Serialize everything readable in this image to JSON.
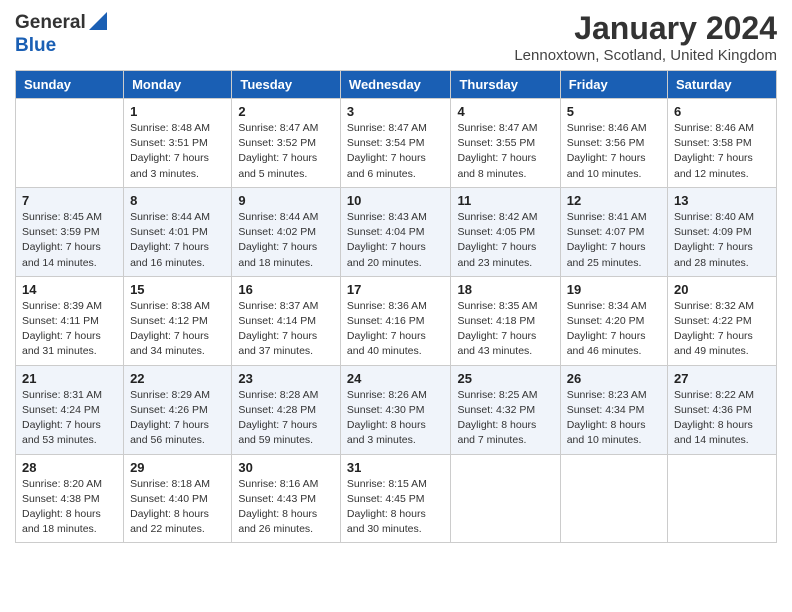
{
  "header": {
    "logo_general": "General",
    "logo_blue": "Blue",
    "month_title": "January 2024",
    "location": "Lennoxtown, Scotland, United Kingdom"
  },
  "days_of_week": [
    "Sunday",
    "Monday",
    "Tuesday",
    "Wednesday",
    "Thursday",
    "Friday",
    "Saturday"
  ],
  "weeks": [
    [
      {
        "number": "",
        "sunrise": "",
        "sunset": "",
        "daylight": ""
      },
      {
        "number": "1",
        "sunrise": "Sunrise: 8:48 AM",
        "sunset": "Sunset: 3:51 PM",
        "daylight": "Daylight: 7 hours and 3 minutes."
      },
      {
        "number": "2",
        "sunrise": "Sunrise: 8:47 AM",
        "sunset": "Sunset: 3:52 PM",
        "daylight": "Daylight: 7 hours and 5 minutes."
      },
      {
        "number": "3",
        "sunrise": "Sunrise: 8:47 AM",
        "sunset": "Sunset: 3:54 PM",
        "daylight": "Daylight: 7 hours and 6 minutes."
      },
      {
        "number": "4",
        "sunrise": "Sunrise: 8:47 AM",
        "sunset": "Sunset: 3:55 PM",
        "daylight": "Daylight: 7 hours and 8 minutes."
      },
      {
        "number": "5",
        "sunrise": "Sunrise: 8:46 AM",
        "sunset": "Sunset: 3:56 PM",
        "daylight": "Daylight: 7 hours and 10 minutes."
      },
      {
        "number": "6",
        "sunrise": "Sunrise: 8:46 AM",
        "sunset": "Sunset: 3:58 PM",
        "daylight": "Daylight: 7 hours and 12 minutes."
      }
    ],
    [
      {
        "number": "7",
        "sunrise": "Sunrise: 8:45 AM",
        "sunset": "Sunset: 3:59 PM",
        "daylight": "Daylight: 7 hours and 14 minutes."
      },
      {
        "number": "8",
        "sunrise": "Sunrise: 8:44 AM",
        "sunset": "Sunset: 4:01 PM",
        "daylight": "Daylight: 7 hours and 16 minutes."
      },
      {
        "number": "9",
        "sunrise": "Sunrise: 8:44 AM",
        "sunset": "Sunset: 4:02 PM",
        "daylight": "Daylight: 7 hours and 18 minutes."
      },
      {
        "number": "10",
        "sunrise": "Sunrise: 8:43 AM",
        "sunset": "Sunset: 4:04 PM",
        "daylight": "Daylight: 7 hours and 20 minutes."
      },
      {
        "number": "11",
        "sunrise": "Sunrise: 8:42 AM",
        "sunset": "Sunset: 4:05 PM",
        "daylight": "Daylight: 7 hours and 23 minutes."
      },
      {
        "number": "12",
        "sunrise": "Sunrise: 8:41 AM",
        "sunset": "Sunset: 4:07 PM",
        "daylight": "Daylight: 7 hours and 25 minutes."
      },
      {
        "number": "13",
        "sunrise": "Sunrise: 8:40 AM",
        "sunset": "Sunset: 4:09 PM",
        "daylight": "Daylight: 7 hours and 28 minutes."
      }
    ],
    [
      {
        "number": "14",
        "sunrise": "Sunrise: 8:39 AM",
        "sunset": "Sunset: 4:11 PM",
        "daylight": "Daylight: 7 hours and 31 minutes."
      },
      {
        "number": "15",
        "sunrise": "Sunrise: 8:38 AM",
        "sunset": "Sunset: 4:12 PM",
        "daylight": "Daylight: 7 hours and 34 minutes."
      },
      {
        "number": "16",
        "sunrise": "Sunrise: 8:37 AM",
        "sunset": "Sunset: 4:14 PM",
        "daylight": "Daylight: 7 hours and 37 minutes."
      },
      {
        "number": "17",
        "sunrise": "Sunrise: 8:36 AM",
        "sunset": "Sunset: 4:16 PM",
        "daylight": "Daylight: 7 hours and 40 minutes."
      },
      {
        "number": "18",
        "sunrise": "Sunrise: 8:35 AM",
        "sunset": "Sunset: 4:18 PM",
        "daylight": "Daylight: 7 hours and 43 minutes."
      },
      {
        "number": "19",
        "sunrise": "Sunrise: 8:34 AM",
        "sunset": "Sunset: 4:20 PM",
        "daylight": "Daylight: 7 hours and 46 minutes."
      },
      {
        "number": "20",
        "sunrise": "Sunrise: 8:32 AM",
        "sunset": "Sunset: 4:22 PM",
        "daylight": "Daylight: 7 hours and 49 minutes."
      }
    ],
    [
      {
        "number": "21",
        "sunrise": "Sunrise: 8:31 AM",
        "sunset": "Sunset: 4:24 PM",
        "daylight": "Daylight: 7 hours and 53 minutes."
      },
      {
        "number": "22",
        "sunrise": "Sunrise: 8:29 AM",
        "sunset": "Sunset: 4:26 PM",
        "daylight": "Daylight: 7 hours and 56 minutes."
      },
      {
        "number": "23",
        "sunrise": "Sunrise: 8:28 AM",
        "sunset": "Sunset: 4:28 PM",
        "daylight": "Daylight: 7 hours and 59 minutes."
      },
      {
        "number": "24",
        "sunrise": "Sunrise: 8:26 AM",
        "sunset": "Sunset: 4:30 PM",
        "daylight": "Daylight: 8 hours and 3 minutes."
      },
      {
        "number": "25",
        "sunrise": "Sunrise: 8:25 AM",
        "sunset": "Sunset: 4:32 PM",
        "daylight": "Daylight: 8 hours and 7 minutes."
      },
      {
        "number": "26",
        "sunrise": "Sunrise: 8:23 AM",
        "sunset": "Sunset: 4:34 PM",
        "daylight": "Daylight: 8 hours and 10 minutes."
      },
      {
        "number": "27",
        "sunrise": "Sunrise: 8:22 AM",
        "sunset": "Sunset: 4:36 PM",
        "daylight": "Daylight: 8 hours and 14 minutes."
      }
    ],
    [
      {
        "number": "28",
        "sunrise": "Sunrise: 8:20 AM",
        "sunset": "Sunset: 4:38 PM",
        "daylight": "Daylight: 8 hours and 18 minutes."
      },
      {
        "number": "29",
        "sunrise": "Sunrise: 8:18 AM",
        "sunset": "Sunset: 4:40 PM",
        "daylight": "Daylight: 8 hours and 22 minutes."
      },
      {
        "number": "30",
        "sunrise": "Sunrise: 8:16 AM",
        "sunset": "Sunset: 4:43 PM",
        "daylight": "Daylight: 8 hours and 26 minutes."
      },
      {
        "number": "31",
        "sunrise": "Sunrise: 8:15 AM",
        "sunset": "Sunset: 4:45 PM",
        "daylight": "Daylight: 8 hours and 30 minutes."
      },
      {
        "number": "",
        "sunrise": "",
        "sunset": "",
        "daylight": ""
      },
      {
        "number": "",
        "sunrise": "",
        "sunset": "",
        "daylight": ""
      },
      {
        "number": "",
        "sunrise": "",
        "sunset": "",
        "daylight": ""
      }
    ]
  ]
}
